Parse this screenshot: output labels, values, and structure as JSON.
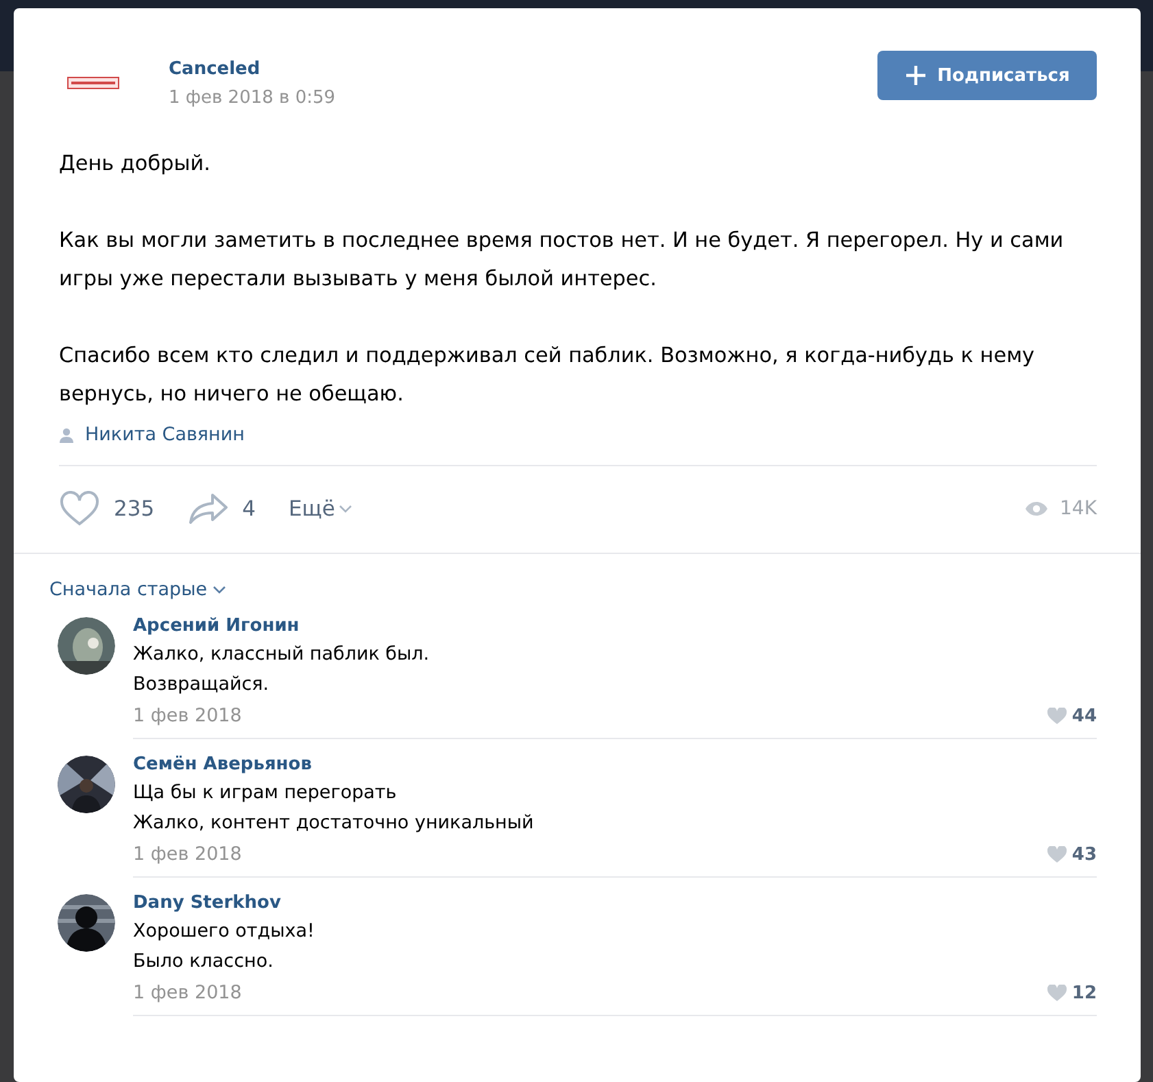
{
  "post": {
    "author": "Canceled",
    "date": "1 фев 2018 в 0:59",
    "subscribe_button": "Подписаться",
    "paragraphs": [
      "День добрый.",
      "Как вы могли заметить в последнее время постов нет. И не будет. Я перегорел. Ну и сами игры уже перестали вызывать у меня былой интерес.",
      "Спасибо всем кто следил и поддерживал сей паблик. Возможно, я когда-нибудь к нему вернусь, но ничего не обещаю."
    ],
    "signer": "Никита Савянин",
    "likes": "235",
    "shares": "4",
    "more": "Ещё",
    "views": "14K"
  },
  "comments_sort": "Сначала старые",
  "comments": [
    {
      "name": "Арсений Игонин",
      "lines": [
        "Жалко, классный паблик был.",
        "Возвращайся."
      ],
      "date": "1 фев 2018",
      "likes": "44"
    },
    {
      "name": "Семён Аверьянов",
      "lines": [
        "Ща бы к играм перегорать",
        "Жалко, контент достаточно уникальный"
      ],
      "date": "1 фев 2018",
      "likes": "43"
    },
    {
      "name": "Dany Sterkhov",
      "lines": [
        "Хорошего отдыха!",
        "Было классно."
      ],
      "date": "1 фев 2018",
      "likes": "12"
    }
  ]
}
